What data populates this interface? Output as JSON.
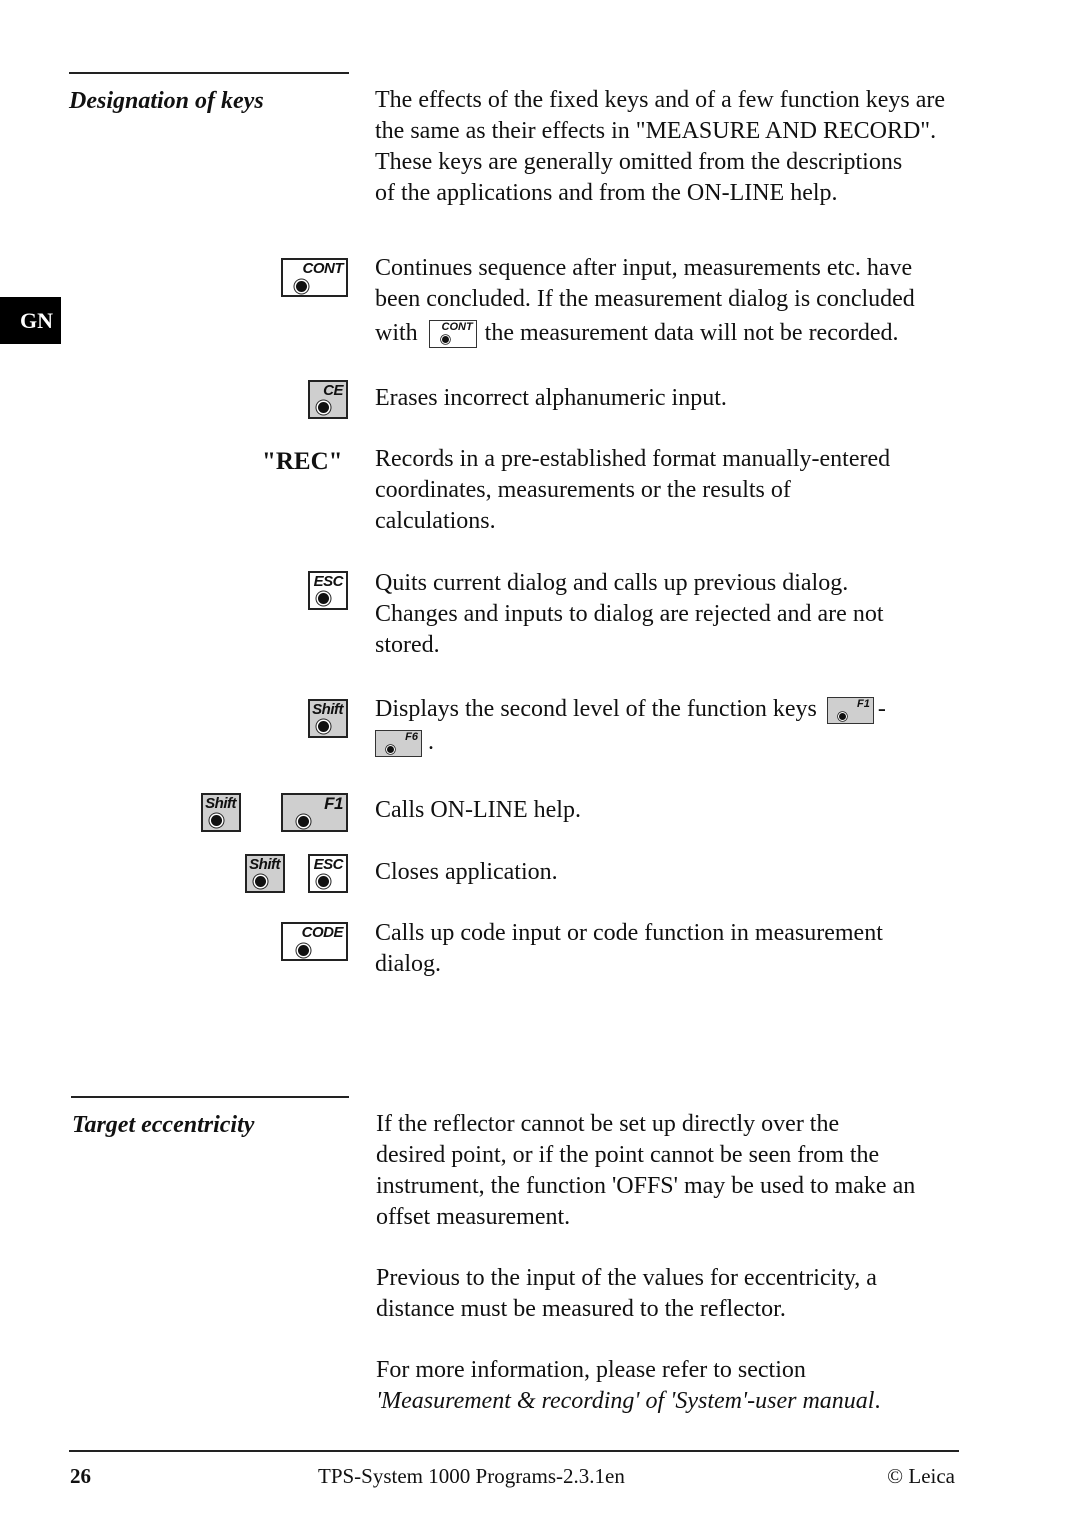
{
  "side_tab": {
    "label": "GN"
  },
  "section1": {
    "heading": "Designation of keys",
    "intro": [
      "The effects of the fixed keys and of a few function keys are",
      "the same as their effects in \"MEASURE AND RECORD\".",
      "These keys are generally omitted from the descriptions",
      "of the applications and from the ON-LINE help."
    ],
    "entries": {
      "cont": {
        "key_label": "CONT",
        "line1": "Continues sequence after input, measurements etc. have",
        "line2": "been concluded. If the measurement dialog is concluded",
        "line3_before": "with",
        "line3_inline_key": "CONT",
        "line3_after": "the measurement data will not be recorded."
      },
      "ce": {
        "key_label": "CE",
        "text": "Erases incorrect alphanumeric input."
      },
      "rec": {
        "label": "\"REC\"",
        "lines": [
          "Records in a pre-established format manually-entered",
          "coordinates, measurements or the results of",
          "calculations."
        ]
      },
      "esc": {
        "key_label": "ESC",
        "lines": [
          "Quits current dialog and calls up previous dialog.",
          "Changes and inputs to dialog are rejected and are not",
          "stored."
        ]
      },
      "shift": {
        "key_label": "Shift",
        "line1": "Displays the second level of the function keys",
        "inline_key_start": "F1",
        "dash": "-",
        "inline_key_end": "F6",
        "period": "."
      },
      "shift_f1": {
        "key1_label": "Shift",
        "key2_label": "F1",
        "text": "Calls ON-LINE help."
      },
      "shift_esc": {
        "key1_label": "Shift",
        "key2_label": "ESC",
        "text": "Closes application."
      },
      "code": {
        "key_label": "CODE",
        "lines": [
          "Calls up code input or code function in measurement",
          "dialog."
        ]
      }
    }
  },
  "section2": {
    "heading": "Target eccentricity",
    "para1": [
      "If the reflector cannot be set up directly over the",
      "desired point, or if the point cannot be seen from the",
      "instrument, the function 'OFFS' may be used to make an",
      "offset measurement."
    ],
    "para2": [
      "Previous to the input of the values for eccentricity, a",
      "distance must be measured to the reflector."
    ],
    "para3": {
      "line1": "For more information, please refer to section",
      "line2_italic": "'Measurement & recording' of 'System'-user manual",
      "line2_end": "."
    }
  },
  "footer": {
    "page_number": "26",
    "title": "TPS-System 1000 Programs-2.3.1en",
    "copyright": "© Leica"
  }
}
